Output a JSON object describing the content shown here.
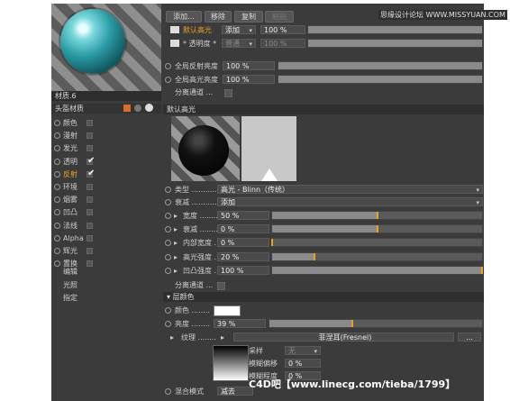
{
  "toolbar": {
    "add": "添加...",
    "remove": "移除",
    "copy": "复制",
    "paste": "粘贴"
  },
  "watermark": "思缘设计论坛 WWW.MISSYUAN.COM",
  "material": {
    "name": "材质.6",
    "head": "头盔材质"
  },
  "channels": [
    {
      "label": "颜色",
      "checked": false,
      "active": false
    },
    {
      "label": "漫射",
      "checked": false,
      "active": false
    },
    {
      "label": "发光",
      "checked": false,
      "active": false
    },
    {
      "label": "透明",
      "checked": true,
      "active": false
    },
    {
      "label": "反射",
      "checked": true,
      "active": true
    },
    {
      "label": "环境",
      "checked": false,
      "active": false
    },
    {
      "label": "烟雾",
      "checked": false,
      "active": false
    },
    {
      "label": "凹凸",
      "checked": false,
      "active": false
    },
    {
      "label": "法线",
      "checked": false,
      "active": false
    },
    {
      "label": "Alpha",
      "checked": false,
      "active": false
    },
    {
      "label": "辉光",
      "checked": false,
      "active": false
    },
    {
      "label": "置换",
      "checked": false,
      "active": false
    }
  ],
  "subitems": [
    "编辑",
    "光照",
    "指定"
  ],
  "layers": {
    "layer1": {
      "name": "默认高光",
      "mode": "添加",
      "value": "100 %",
      "value_fill": 1.0
    },
    "layer2": {
      "name": "* 透明度 *",
      "mode": "普通",
      "value": "100 %",
      "value_fill": 1.0
    }
  },
  "global_reflect": {
    "label": "全局反射亮度",
    "value": "100 %",
    "fill": 1.0
  },
  "global_spec": {
    "label": "全局高光亮度",
    "value": "100 %",
    "fill": 1.0
  },
  "sep_channel": "分离通道 ...",
  "section_default": "默认高光",
  "type": {
    "label": "类型 ...........",
    "value": "高光 - Blinn（传统）"
  },
  "attenuation": {
    "label": "衰减 ...........",
    "value": "添加"
  },
  "params": [
    {
      "label": "宽度 ........",
      "value": "50 %",
      "fill": 0.5
    },
    {
      "label": "衰减 ........",
      "value": "0 %",
      "fill": 0.5
    },
    {
      "label": "内部宽度 ....",
      "value": "0 %",
      "fill": 0.0
    },
    {
      "label": "高光强度 ....",
      "value": "20 %",
      "fill": 0.2
    },
    {
      "label": "凹凸强度 ....",
      "value": "100 %",
      "fill": 1.0
    }
  ],
  "sep_channel2": "分离通道 ...",
  "layer_color": {
    "section": "层颜色",
    "color_label": "颜色 ........",
    "brightness_label": "亮度 ........",
    "brightness": "39 %",
    "brightness_fill": 0.39,
    "texture_label": "纹理 ........",
    "texture_value": "菲涅耳(Fresnel)",
    "more": "..."
  },
  "sampling": {
    "label": "采样",
    "value": "无"
  },
  "blur_offset": {
    "label": "模糊偏移",
    "value": "0 %"
  },
  "blur_scale": {
    "label": "模糊程度",
    "value": "0 %"
  },
  "blend": {
    "label": "混合模式",
    "value": "减去"
  },
  "footer": "C4D吧【www.linecg.com/tieba/1799】",
  "colors": {
    "accent": "#f0a020",
    "panel": "#3b3b3b"
  }
}
